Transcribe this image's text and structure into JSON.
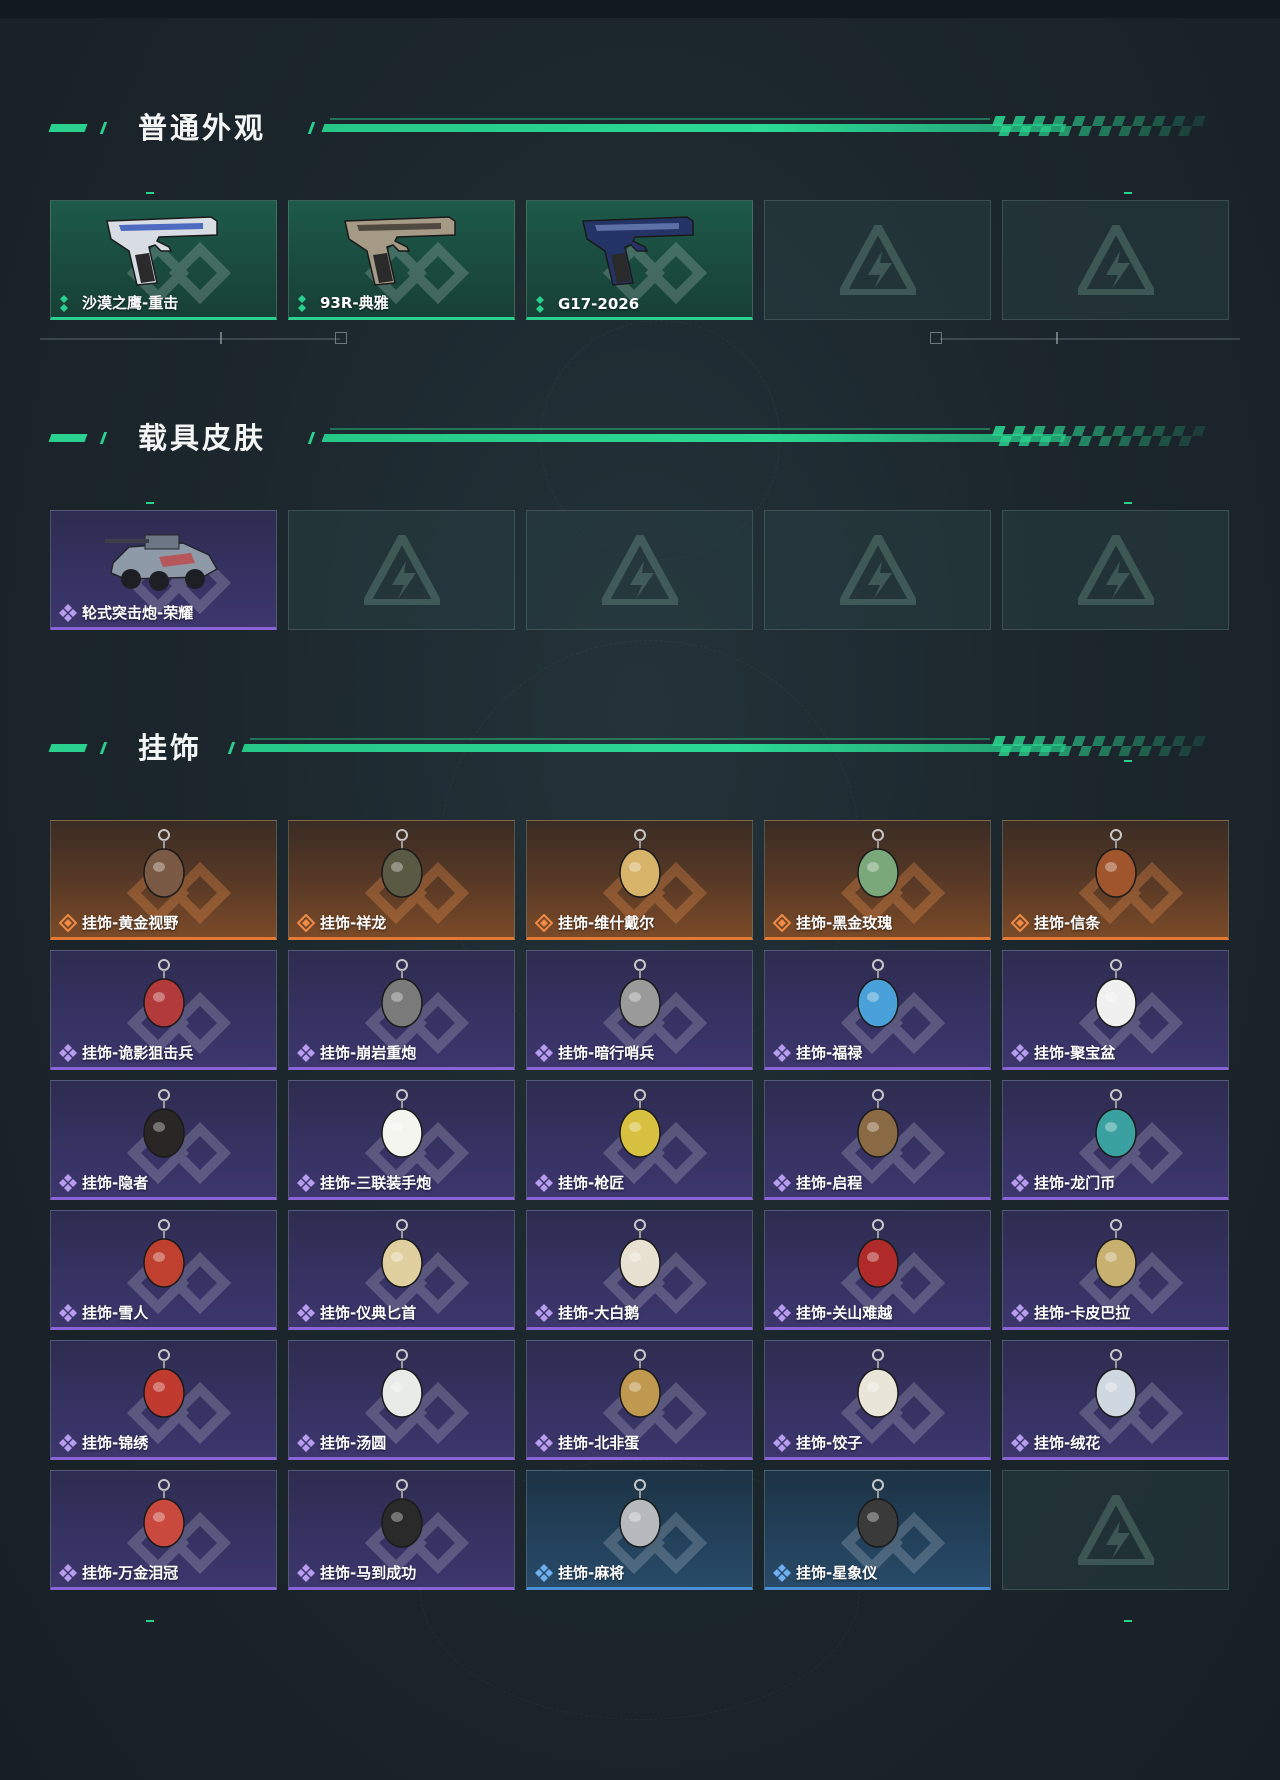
{
  "sections": [
    {
      "title": "普通外观",
      "items": [
        {
          "label": "沙漠之鹰-重击",
          "rarity": "green",
          "icon": "pistol-icon"
        },
        {
          "label": "93R-典雅",
          "rarity": "green",
          "icon": "pistol-icon"
        },
        {
          "label": "G17-2026",
          "rarity": "green",
          "icon": "pistol-icon"
        },
        {
          "label": "",
          "rarity": "empty",
          "icon": "placeholder-logo-icon"
        },
        {
          "label": "",
          "rarity": "empty",
          "icon": "placeholder-logo-icon"
        }
      ]
    },
    {
      "title": "载具皮肤",
      "items": [
        {
          "label": "轮式突击炮-荣耀",
          "rarity": "purple",
          "icon": "vehicle-icon"
        },
        {
          "label": "",
          "rarity": "empty",
          "icon": "placeholder-logo-icon"
        },
        {
          "label": "",
          "rarity": "empty",
          "icon": "placeholder-logo-icon"
        },
        {
          "label": "",
          "rarity": "empty",
          "icon": "placeholder-logo-icon"
        },
        {
          "label": "",
          "rarity": "empty",
          "icon": "placeholder-logo-icon"
        }
      ]
    },
    {
      "title": "挂饰",
      "items": [
        {
          "label": "挂饰-黄金视野",
          "rarity": "orange",
          "icon": "charm-icon"
        },
        {
          "label": "挂饰-祥龙",
          "rarity": "orange",
          "icon": "charm-icon"
        },
        {
          "label": "挂饰-维什戴尔",
          "rarity": "orange",
          "icon": "charm-icon"
        },
        {
          "label": "挂饰-黑金玫瑰",
          "rarity": "orange",
          "icon": "charm-icon"
        },
        {
          "label": "挂饰-信条",
          "rarity": "orange",
          "icon": "charm-icon"
        },
        {
          "label": "挂饰-诡影狙击兵",
          "rarity": "purple",
          "icon": "charm-icon"
        },
        {
          "label": "挂饰-崩岩重炮",
          "rarity": "purple",
          "icon": "charm-icon"
        },
        {
          "label": "挂饰-暗行哨兵",
          "rarity": "purple",
          "icon": "charm-icon"
        },
        {
          "label": "挂饰-福禄",
          "rarity": "purple",
          "icon": "charm-icon"
        },
        {
          "label": "挂饰-聚宝盆",
          "rarity": "purple",
          "icon": "charm-icon"
        },
        {
          "label": "挂饰-隐者",
          "rarity": "purple",
          "icon": "charm-icon"
        },
        {
          "label": "挂饰-三联装手炮",
          "rarity": "purple",
          "icon": "charm-icon"
        },
        {
          "label": "挂饰-枪匠",
          "rarity": "purple",
          "icon": "charm-icon"
        },
        {
          "label": "挂饰-启程",
          "rarity": "purple",
          "icon": "charm-icon"
        },
        {
          "label": "挂饰-龙门币",
          "rarity": "purple",
          "icon": "charm-icon"
        },
        {
          "label": "挂饰-雪人",
          "rarity": "purple",
          "icon": "charm-icon"
        },
        {
          "label": "挂饰-仪典匕首",
          "rarity": "purple",
          "icon": "charm-icon"
        },
        {
          "label": "挂饰-大白鹅",
          "rarity": "purple",
          "icon": "charm-icon"
        },
        {
          "label": "挂饰-关山难越",
          "rarity": "purple",
          "icon": "charm-icon"
        },
        {
          "label": "挂饰-卡皮巴拉",
          "rarity": "purple",
          "icon": "charm-icon"
        },
        {
          "label": "挂饰-锦绣",
          "rarity": "purple",
          "icon": "charm-icon"
        },
        {
          "label": "挂饰-汤圆",
          "rarity": "purple",
          "icon": "charm-icon"
        },
        {
          "label": "挂饰-北非蛋",
          "rarity": "purple",
          "icon": "charm-icon"
        },
        {
          "label": "挂饰-饺子",
          "rarity": "purple",
          "icon": "charm-icon"
        },
        {
          "label": "挂饰-绒花",
          "rarity": "purple",
          "icon": "charm-icon"
        },
        {
          "label": "挂饰-万金泪冠",
          "rarity": "purple",
          "icon": "charm-icon"
        },
        {
          "label": "挂饰-马到成功",
          "rarity": "purple",
          "icon": "charm-icon"
        },
        {
          "label": "挂饰-麻将",
          "rarity": "blue",
          "icon": "charm-icon"
        },
        {
          "label": "挂饰-星象仪",
          "rarity": "blue",
          "icon": "charm-icon"
        },
        {
          "label": "",
          "rarity": "empty",
          "icon": "placeholder-logo-icon"
        }
      ]
    }
  ],
  "colors": {
    "accent": "#2ad18e",
    "green": "#2ad18e",
    "purple": "#8a63d6",
    "orange": "#e07a35",
    "blue": "#4a8fd6"
  }
}
